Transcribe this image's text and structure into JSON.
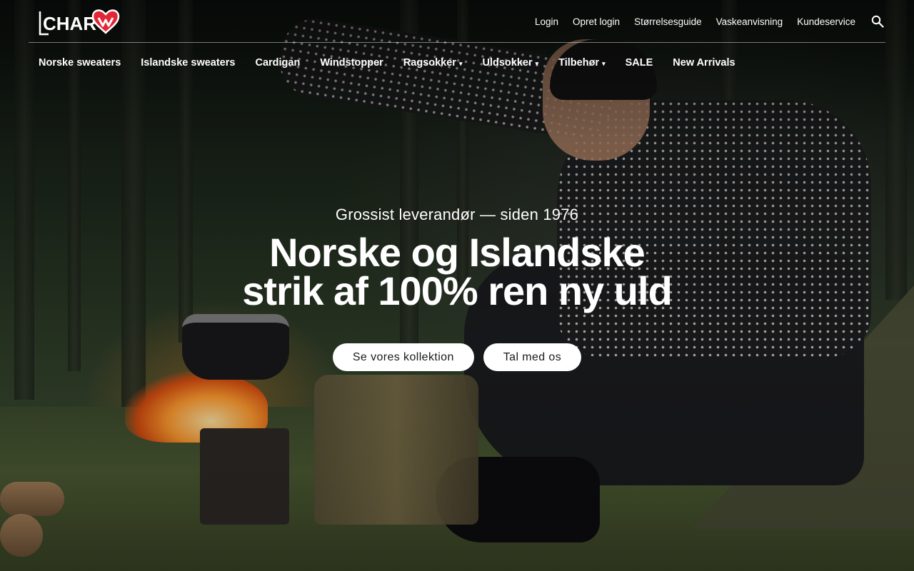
{
  "brand": {
    "name": "CHARM",
    "logo_color": "#e32636"
  },
  "header": {
    "util_links": [
      "Login",
      "Opret login",
      "Størrelsesguide",
      "Vaskeanvisning",
      "Kundeservice"
    ],
    "search_icon": "search-icon"
  },
  "nav": {
    "items": [
      {
        "label": "Norske sweaters",
        "has_dropdown": false
      },
      {
        "label": "Islandske sweaters",
        "has_dropdown": false
      },
      {
        "label": "Cardigan",
        "has_dropdown": false
      },
      {
        "label": "Windstopper",
        "has_dropdown": false
      },
      {
        "label": "Ragsokker",
        "has_dropdown": true
      },
      {
        "label": "Uldsokker",
        "has_dropdown": true
      },
      {
        "label": "Tilbehør",
        "has_dropdown": true
      },
      {
        "label": "SALE",
        "has_dropdown": false
      },
      {
        "label": "New Arrivals",
        "has_dropdown": false
      }
    ],
    "caret": "▾"
  },
  "hero": {
    "eyebrow": "Grossist leverandør — siden 1976",
    "headline_line1": "Norske og Islandske",
    "headline_line2": "strik af 100% ren ny uld",
    "primary_cta": "Se vores kollektion",
    "secondary_cta": "Tal med os"
  }
}
